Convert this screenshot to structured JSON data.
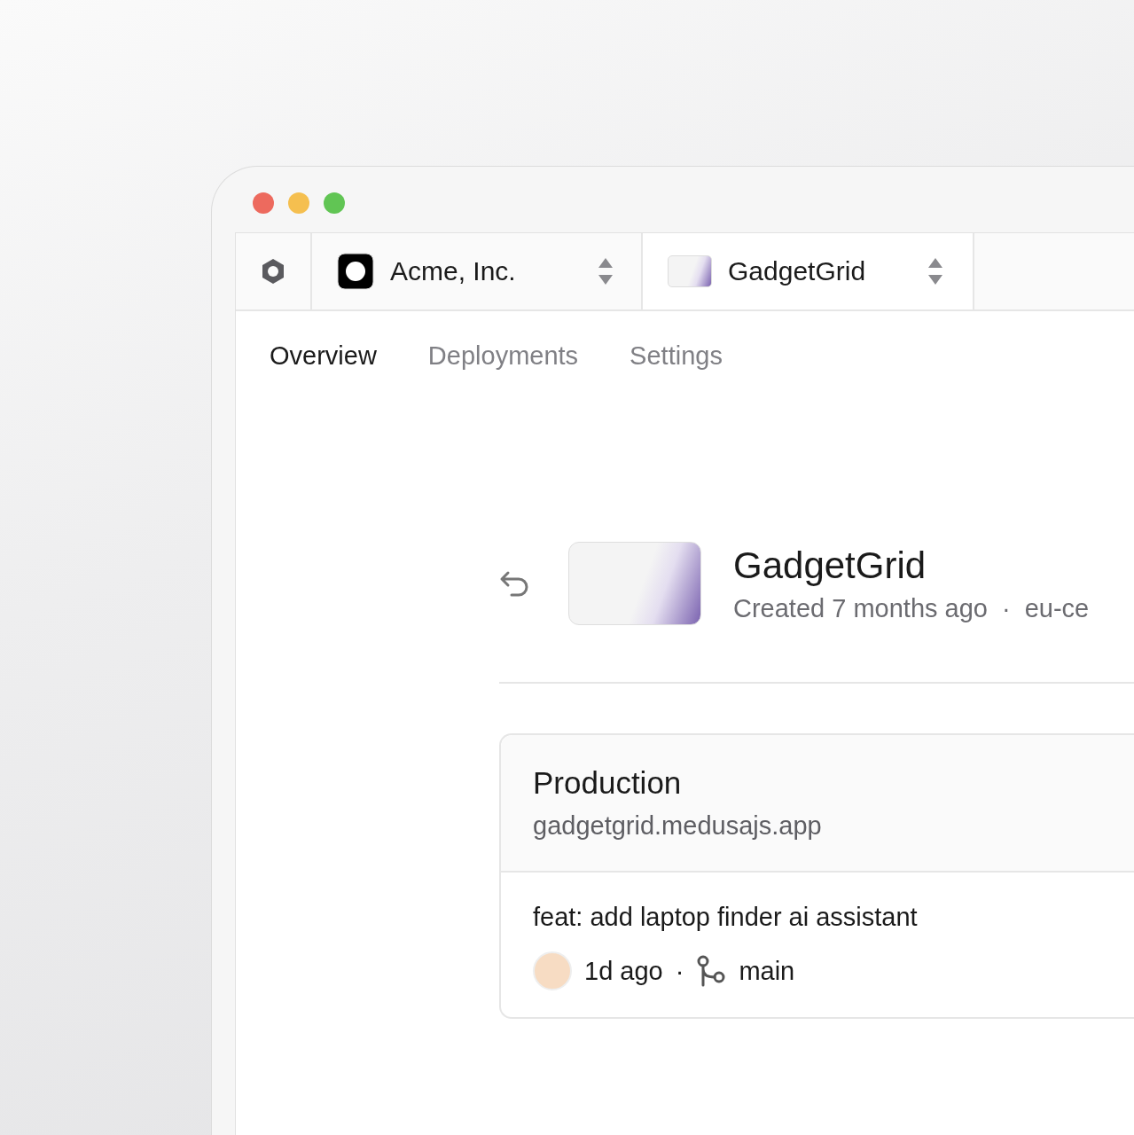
{
  "top_bar": {
    "org": {
      "name": "Acme, Inc."
    },
    "project": {
      "name": "GadgetGrid"
    }
  },
  "tabs": [
    {
      "label": "Overview",
      "selected": true
    },
    {
      "label": "Deployments",
      "selected": false
    },
    {
      "label": "Settings",
      "selected": false
    }
  ],
  "project_header": {
    "title": "GadgetGrid",
    "created": "Created 7 months ago",
    "separator": "·",
    "region": "eu-ce"
  },
  "production_card": {
    "title": "Production",
    "domain": "gadgetgrid.medusajs.app",
    "commit_message": "feat: add laptop finder ai assistant",
    "time": "1d ago",
    "separator": "·",
    "branch": "main"
  }
}
